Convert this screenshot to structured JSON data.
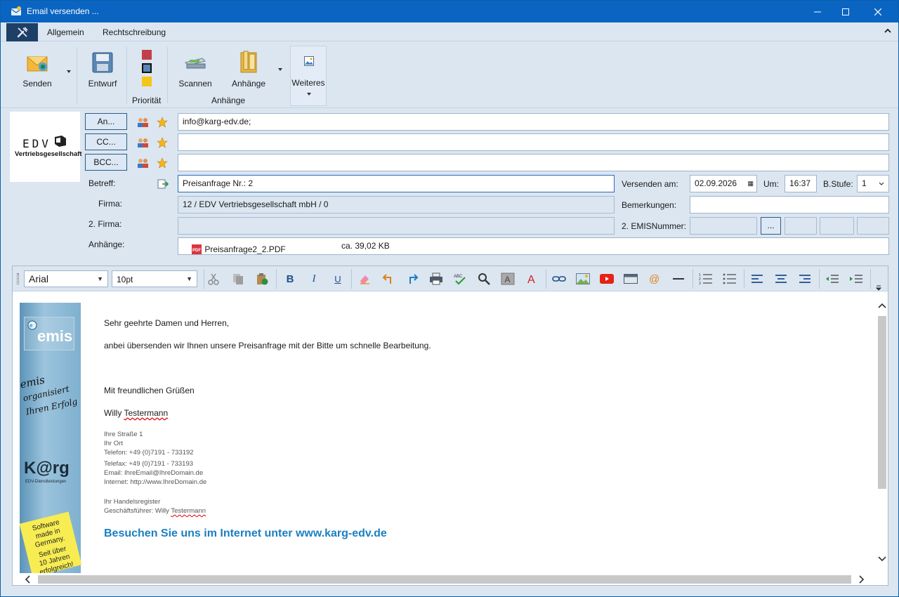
{
  "window": {
    "title": "Email versenden ..."
  },
  "ribbon_tabs": [
    "Allgemein",
    "Rechtschreibung"
  ],
  "ribbon": {
    "send": "Senden",
    "draft": "Entwurf",
    "priority_group": "Priorität",
    "scan": "Scannen",
    "attachments": "Anhänge",
    "attachments_group": "Anhänge",
    "more": "Weiteres"
  },
  "logo": {
    "line1": "EDV",
    "line2": "Vertriebsgesellschaft"
  },
  "recipients": {
    "to_btn": "An...",
    "cc_btn": "CC...",
    "bcc_btn": "BCC...",
    "to": "info@karg-edv.de;",
    "cc": "",
    "bcc": ""
  },
  "fields": {
    "subject_lbl": "Betreff:",
    "subject": "Preisanfrage Nr.: 2",
    "company_lbl": "Firma:",
    "company": "12 / EDV Vertriebsgesellschaft mbH / 0",
    "company2_lbl": "2. Firma:",
    "company2": "",
    "attachments_lbl": "Anhänge:",
    "attachment_name": "Preisanfrage2_2.PDF",
    "attachment_size": "ca. 39,02 KB",
    "send_on_lbl": "Versenden am:",
    "send_date": "02.09.2026",
    "time_lbl": "Um:",
    "time": "16:37",
    "level_lbl": "B.Stufe:",
    "level": "1",
    "remarks_lbl": "Bemerkungen:",
    "remarks": "",
    "emis_lbl": "2. EMISNummer:",
    "emis_btn": "..."
  },
  "editor": {
    "font": "Arial",
    "size": "10pt"
  },
  "body": {
    "greeting": "Sehr geehrte Damen und Herren,",
    "line1": "anbei übersenden wir Ihnen unsere Preisanfrage mit der Bitte um schnelle Bearbeitung.",
    "closing": "Mit freundlichen Grüßen",
    "name_first": "Willy ",
    "name_last": "Testermann",
    "sig1": "Ihre Straße 1",
    "sig2": "Ihr Ort",
    "sig3": "Telefon: +49 (0)7191 - 733192",
    "sig4": "Telefax: +49 (0)7191 - 733193",
    "sig5": "Email:  IhreEmail@IhreDomain.de",
    "sig6": "Internet: http://www.IhreDomain.de",
    "sig7": "Ihr Handelsregister",
    "sig8_a": "Geschäftsführer: Willy ",
    "sig8_b": "Testermann",
    "link": "Besuchen Sie uns im Internet unter www.karg-edv.de"
  },
  "banner": {
    "brand": "emis",
    "script1": "emis",
    "script2": "organisiert",
    "script3": "Ihren Erfolg",
    "karg": "K@rg",
    "karg_sub": "EDV-Dienstleistungen",
    "note1": "Software",
    "note2": "made in",
    "note3": "Germany.",
    "note4": "Seit über",
    "note5": "10 Jahren",
    "note6": "erfolgreich!"
  },
  "colors": {
    "titlebar": "#0a64c2",
    "accent": "#1a7fc1",
    "ribbon": "#dbe6f1"
  }
}
